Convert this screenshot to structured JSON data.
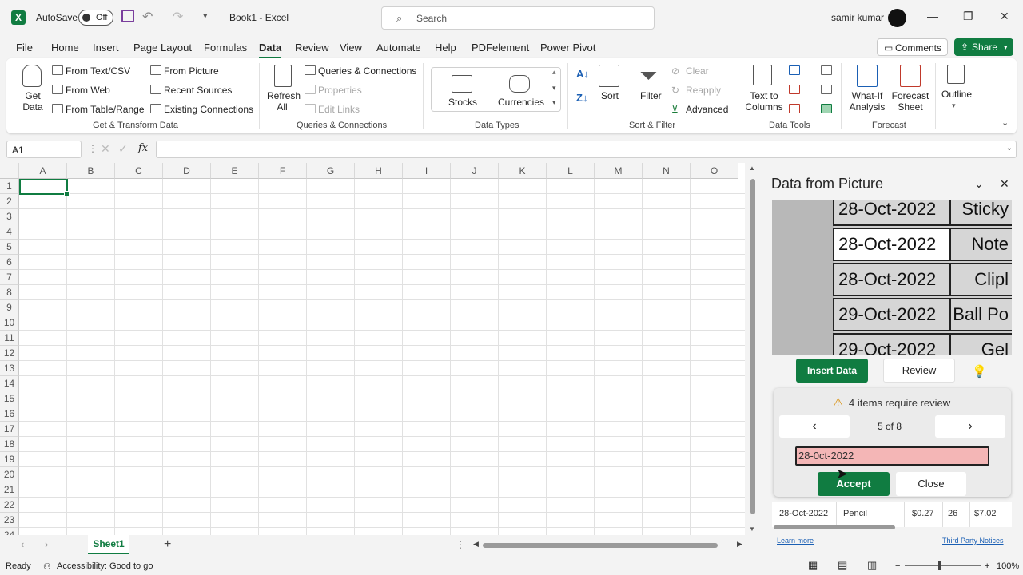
{
  "titlebar": {
    "autosave_label": "AutoSave",
    "autosave_state": "Off",
    "doc_title": "Book1 - Excel",
    "search_placeholder": "Search",
    "user_name": "samir kumar"
  },
  "tabs": [
    "File",
    "Home",
    "Insert",
    "Page Layout",
    "Formulas",
    "Data",
    "Review",
    "View",
    "Automate",
    "Help",
    "PDFelement",
    "Power Pivot"
  ],
  "active_tab": "Data",
  "comments_label": "Comments",
  "share_label": "Share",
  "ribbon": {
    "get_data": "Get Data",
    "from_text_csv": "From Text/CSV",
    "from_web": "From Web",
    "from_table_range": "From Table/Range",
    "from_picture": "From Picture",
    "recent_sources": "Recent Sources",
    "existing_connections": "Existing Connections",
    "group_get_transform": "Get & Transform Data",
    "refresh_all": "Refresh All",
    "queries_connections": "Queries & Connections",
    "properties": "Properties",
    "edit_links": "Edit Links",
    "group_queries": "Queries & Connections",
    "stocks": "Stocks",
    "currencies": "Currencies",
    "group_data_types": "Data Types",
    "sort": "Sort",
    "filter": "Filter",
    "clear": "Clear",
    "reapply": "Reapply",
    "advanced": "Advanced",
    "group_sort_filter": "Sort & Filter",
    "text_to_columns": "Text to Columns",
    "group_data_tools": "Data Tools",
    "what_if": "What-If Analysis",
    "forecast_sheet": "Forecast Sheet",
    "group_forecast": "Forecast",
    "outline": "Outline"
  },
  "formula_bar": {
    "name_box": "A1",
    "fx": "fx",
    "formula": ""
  },
  "grid": {
    "columns": [
      "A",
      "B",
      "C",
      "D",
      "E",
      "F",
      "G",
      "H",
      "I",
      "J",
      "K",
      "L",
      "M",
      "N",
      "O"
    ],
    "rows": [
      "1",
      "2",
      "3",
      "4",
      "5",
      "6",
      "7",
      "8",
      "9",
      "10",
      "11",
      "12",
      "13",
      "14",
      "15",
      "16",
      "17",
      "18",
      "19",
      "20",
      "21",
      "22",
      "23",
      "24"
    ],
    "selected_cell": "A1"
  },
  "sheet_tab": "Sheet1",
  "status": {
    "ready": "Ready",
    "accessibility": "Accessibility: Good to go",
    "zoom": "100%"
  },
  "pane": {
    "title": "Data from Picture",
    "preview_rows": [
      {
        "date": "28-Oct-2022",
        "item": "Sticky"
      },
      {
        "date": "28-Oct-2022",
        "item": "Note"
      },
      {
        "date": "28-Oct-2022",
        "item": "Clipl"
      },
      {
        "date": "29-Oct-2022",
        "item": "Ball Po"
      },
      {
        "date": "29-Oct-2022",
        "item": "Gel"
      }
    ],
    "insert_data": "Insert Data",
    "review": "Review",
    "review_notice": "4 items require review",
    "counter": "5 of 8",
    "review_value": "28-0ct-2022",
    "accept": "Accept",
    "close": "Close",
    "result_row": [
      "28-Oct-2022",
      "Pencil",
      "$0.27",
      "26",
      "$7.02"
    ],
    "learn_more": "Learn more",
    "third_party": "Third Party Notices"
  },
  "colors": {
    "accent": "#107c41",
    "review_highlight": "#f4b6b6"
  }
}
